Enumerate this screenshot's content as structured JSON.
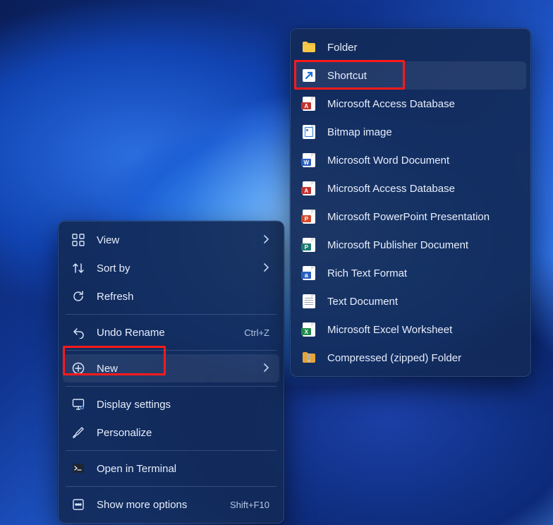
{
  "main_menu": {
    "view": {
      "label": "View"
    },
    "sort_by": {
      "label": "Sort by"
    },
    "refresh": {
      "label": "Refresh"
    },
    "undo_rename": {
      "label": "Undo Rename",
      "accel": "Ctrl+Z"
    },
    "new": {
      "label": "New"
    },
    "display_settings": {
      "label": "Display settings"
    },
    "personalize": {
      "label": "Personalize"
    },
    "open_terminal": {
      "label": "Open in Terminal"
    },
    "more_options": {
      "label": "Show more options",
      "accel": "Shift+F10"
    }
  },
  "new_menu": {
    "folder": {
      "label": "Folder"
    },
    "shortcut": {
      "label": "Shortcut"
    },
    "access1": {
      "label": "Microsoft Access Database"
    },
    "bitmap": {
      "label": "Bitmap image"
    },
    "word": {
      "label": "Microsoft Word Document"
    },
    "access2": {
      "label": "Microsoft Access Database"
    },
    "powerpoint": {
      "label": "Microsoft PowerPoint Presentation"
    },
    "publisher": {
      "label": "Microsoft Publisher Document"
    },
    "rtf": {
      "label": "Rich Text Format"
    },
    "text": {
      "label": "Text Document"
    },
    "excel": {
      "label": "Microsoft Excel Worksheet"
    },
    "zip": {
      "label": "Compressed (zipped) Folder"
    }
  },
  "icon_colors": {
    "folder": "#f7c948",
    "shortcut_bg": "#ffffff",
    "shortcut_arrow": "#1b6fe0",
    "access": "#c2332f",
    "bitmap": "#2d7ad6",
    "word": "#2a5fbf",
    "powerpoint": "#d34a2a",
    "publisher": "#1c7d6f",
    "rtf": "#2a5fbf",
    "text": "#e6e6e6",
    "excel": "#1f8b4a",
    "zip": "#e6a53a"
  }
}
